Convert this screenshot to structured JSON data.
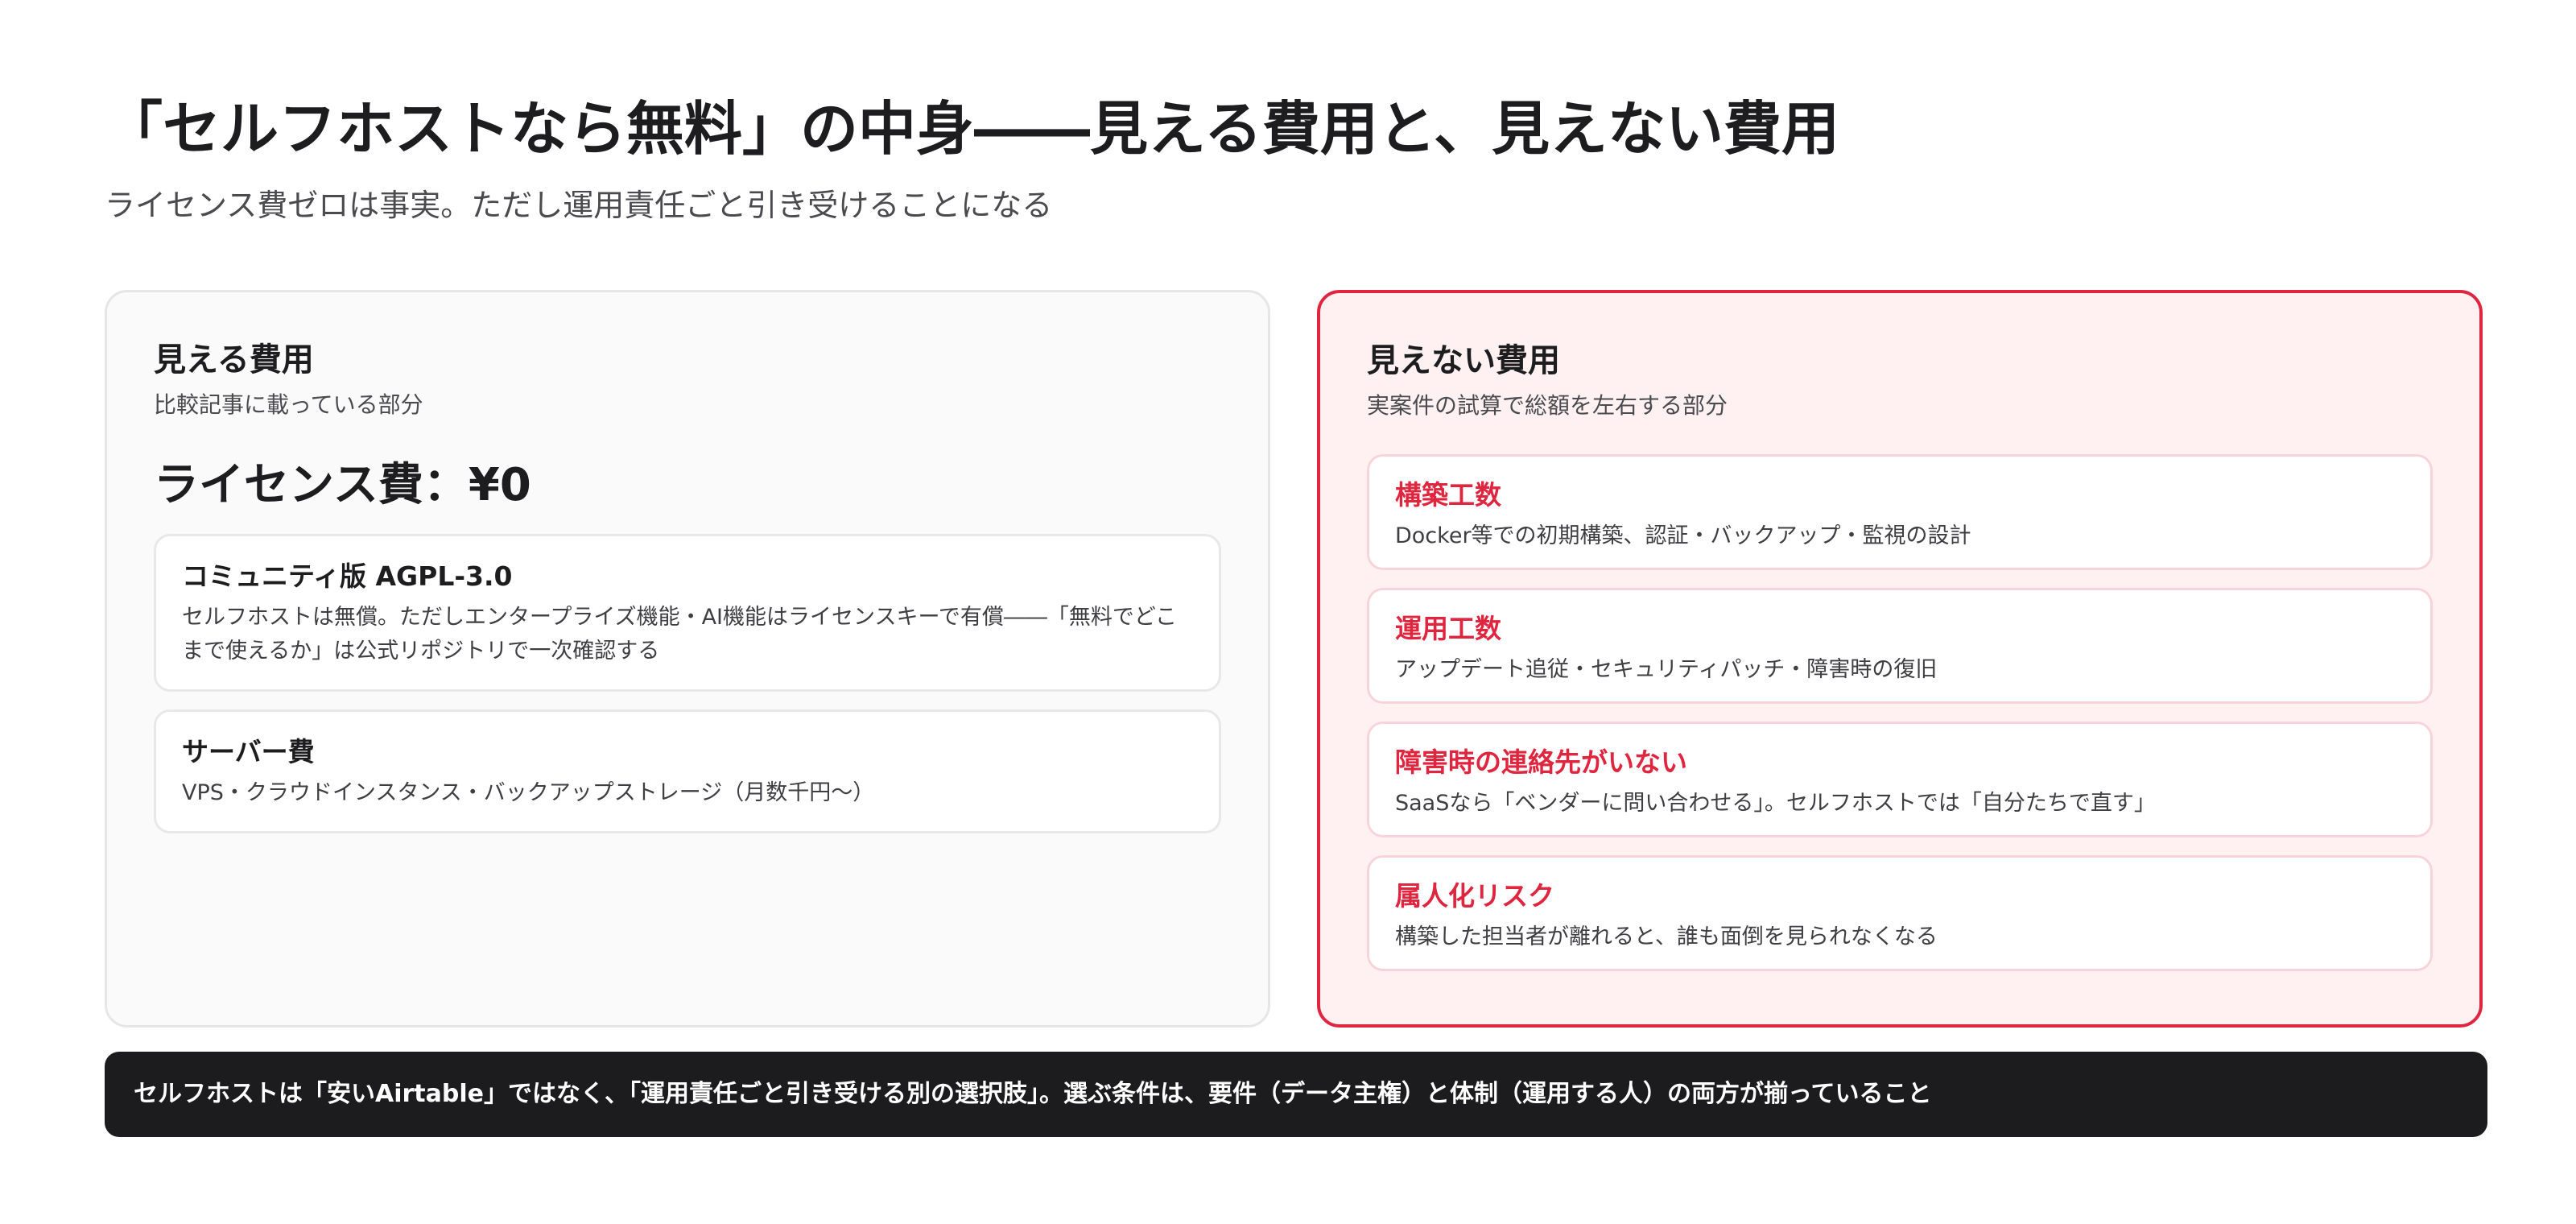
{
  "header": {
    "title": "「セルフホストなら無料」の中身――見える費用と、見えない費用",
    "subtitle": "ライセンス費ゼロは事実。ただし運用責任ごと引き受けることになる"
  },
  "visible_costs": {
    "title": "見える費用",
    "note": "比較記事に載っている部分",
    "license_line": "ライセンス費：¥0",
    "items": [
      {
        "title": "コミュニティ版 AGPL-3.0",
        "description": "セルフホストは無償。ただしエンタープライズ機能・AI機能はライセンスキーで有償――「無料でどこまで使えるか」は公式リポジトリで一次確認する"
      },
      {
        "title": "サーバー費",
        "description": "VPS・クラウドインスタンス・バックアップストレージ（月数千円〜）"
      }
    ]
  },
  "hidden_costs": {
    "title": "見えない費用",
    "note": "実案件の試算で総額を左右する部分",
    "items": [
      {
        "title": "構築工数",
        "description": "Docker等での初期構築、認証・バックアップ・監視の設計"
      },
      {
        "title": "運用工数",
        "description": "アップデート追従・セキュリティパッチ・障害時の復旧"
      },
      {
        "title": "障害時の連絡先がいない",
        "description": "SaaSなら「ベンダーに問い合わせる」。セルフホストでは「自分たちで直す」"
      },
      {
        "title": "属人化リスク",
        "description": "構築した担当者が離れると、誰も面倒を見られなくなる"
      }
    ]
  },
  "summary": {
    "text": "セルフホストは「安いAirtable」ではなく、「運用責任ごと引き受ける別の選択肢」。選ぶ条件は、要件（データ主権）と体制（運用する人）の両方が揃っていること"
  },
  "colors": {
    "accent_red": "#e0253f",
    "hidden_panel_bg": "#fff1f2",
    "visible_panel_bg": "#fafafa",
    "summary_bg": "#1c1c1e"
  }
}
